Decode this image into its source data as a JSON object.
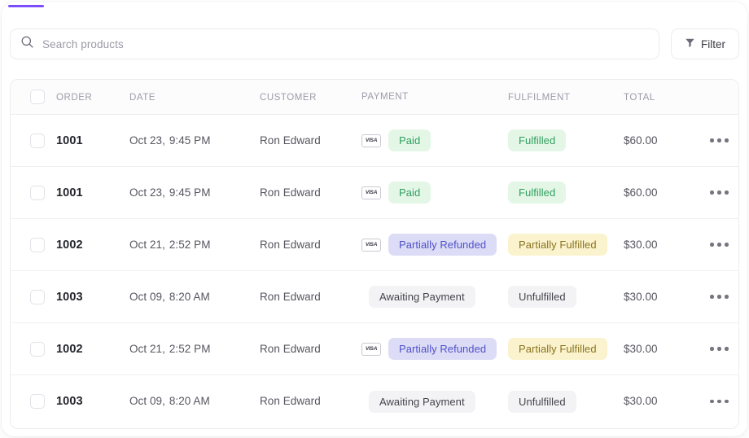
{
  "accent": {
    "color": "#7c4dff"
  },
  "toolbar": {
    "search_placeholder": "Search products",
    "search_value": "",
    "search_icon": "search-icon",
    "filter_label": "Filter",
    "filter_icon": "funnel-icon"
  },
  "table": {
    "columns": [
      {
        "key": "order",
        "label": "ORDER"
      },
      {
        "key": "date",
        "label": "DATE"
      },
      {
        "key": "cust",
        "label": "CUSTOMER"
      },
      {
        "key": "pay",
        "label": "PAYMENT"
      },
      {
        "key": "fulfil",
        "label": "FULFILMENT"
      },
      {
        "key": "total",
        "label": "TOTAL"
      }
    ],
    "rows": [
      {
        "order": "1001",
        "date_day": "Oct 23,",
        "date_time": "9:45 PM",
        "customer": "Ron Edward",
        "card": "VISA",
        "has_card": true,
        "payment": "Paid",
        "payment_style": "badge-green",
        "fulfilment": "Fulfilled",
        "fulfilment_style": "badge-green",
        "total": "$60.00",
        "menu": "row-actions"
      },
      {
        "order": "1001",
        "date_day": "Oct 23,",
        "date_time": "9:45 PM",
        "customer": "Ron Edward",
        "card": "VISA",
        "has_card": true,
        "payment": "Paid",
        "payment_style": "badge-green",
        "fulfilment": "Fulfilled",
        "fulfilment_style": "badge-green",
        "total": "$60.00",
        "menu": "row-actions"
      },
      {
        "order": "1002",
        "date_day": "Oct 21,",
        "date_time": "2:52 PM",
        "customer": "Ron Edward",
        "card": "VISA",
        "has_card": true,
        "payment": "Partially Refunded",
        "payment_style": "badge-purple",
        "fulfilment": "Partially Fulfilled",
        "fulfilment_style": "badge-yellow",
        "total": "$30.00",
        "menu": "row-actions"
      },
      {
        "order": "1003",
        "date_day": "Oct 09,",
        "date_time": "8:20 AM",
        "customer": "Ron Edward",
        "card": "",
        "has_card": false,
        "payment": "Awaiting Payment",
        "payment_style": "badge-gray",
        "fulfilment": "Unfulfilled",
        "fulfilment_style": "badge-gray",
        "total": "$30.00",
        "menu": "row-actions"
      },
      {
        "order": "1002",
        "date_day": "Oct 21,",
        "date_time": "2:52 PM",
        "customer": "Ron Edward",
        "card": "VISA",
        "has_card": true,
        "payment": "Partially Refunded",
        "payment_style": "badge-purple",
        "fulfilment": "Partially Fulfilled",
        "fulfilment_style": "badge-yellow",
        "total": "$30.00",
        "menu": "row-actions"
      },
      {
        "order": "1003",
        "date_day": "Oct 09,",
        "date_time": "8:20 AM",
        "customer": "Ron Edward",
        "card": "",
        "has_card": false,
        "payment": "Awaiting Payment",
        "payment_style": "badge-gray",
        "fulfilment": "Unfulfilled",
        "fulfilment_style": "badge-gray",
        "total": "$30.00",
        "menu": "row-actions"
      }
    ]
  },
  "colors": {
    "accent_purple": "#7c4dff",
    "badge_green_bg": "#e4f7e7",
    "badge_green_fg": "#2f9e5e",
    "badge_purple_bg": "#dcdcf7",
    "badge_purple_fg": "#5050c8",
    "badge_yellow_bg": "#fbf3cd",
    "badge_yellow_fg": "#8a7320",
    "badge_gray_bg": "#f3f3f5",
    "badge_gray_fg": "#44444e"
  }
}
